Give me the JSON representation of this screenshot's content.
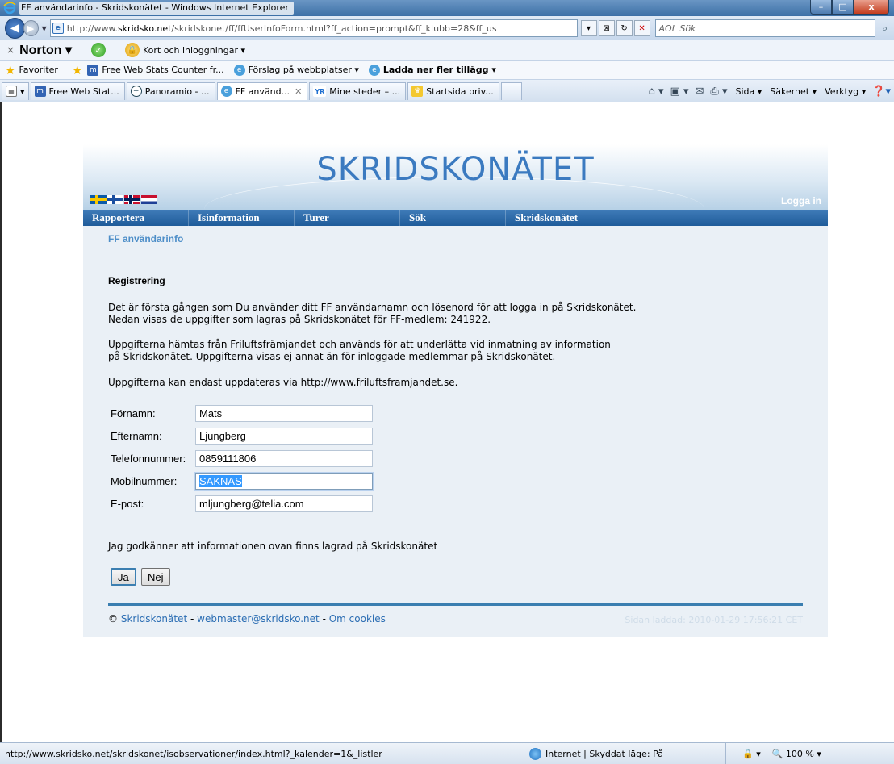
{
  "window": {
    "title": "FF användarinfo - Skridskonätet - Windows Internet Explorer",
    "min": "–",
    "max": "□",
    "close": "x"
  },
  "addressbar": {
    "url_prefix": "http://www.",
    "url_domain": "skridsko.net",
    "url_rest": "/skridskonet/ff/ffUserInfoForm.html?ff_action=prompt&ff_klubb=28&ff_us",
    "search_placeholder": "AOL Sök"
  },
  "norton": {
    "brand": "Norton",
    "identity_label": "Kort och inloggningar ▾"
  },
  "favorites": {
    "label": "Favoriter",
    "items": [
      {
        "label": "Free Web Stats Counter fr...",
        "icon": "m"
      },
      {
        "label": "Förslag på webbplatser ▾",
        "icon": "ie"
      },
      {
        "label": "Ladda ner fler tillägg ▾",
        "icon": "ie",
        "bold": true
      }
    ]
  },
  "tabs": [
    {
      "label": "Free Web Stat...",
      "icon": "m"
    },
    {
      "label": "Panoramio - ...",
      "icon": "pano"
    },
    {
      "label": "FF använd...",
      "icon": "ie",
      "active": true
    },
    {
      "label": "Mine steder – ...",
      "icon": "yr"
    },
    {
      "label": "Startsida priv...",
      "icon": "home"
    }
  ],
  "commands": {
    "page": "Sida ▾",
    "safety": "Säkerhet ▾",
    "tools": "Verktyg ▾"
  },
  "site": {
    "logo": "SKRIDSKONÄTET",
    "login": "Logga in",
    "menu": [
      "Rapportera",
      "Isinformation",
      "Turer",
      "Sök",
      "Skridskonätet"
    ],
    "subtitle": "FF användarinfo",
    "heading": "Registrering",
    "para1_line1": "Det är första gången som Du använder ditt FF användarnamn och lösenord för att logga in på Skridskonätet.",
    "para1_line2": "Nedan visas de uppgifter som lagras på Skridskonätet för FF-medlem: 241922.",
    "para2_line1": "Uppgifterna hämtas från Friluftsfrämjandet och används för att underlätta vid inmatning av information",
    "para2_line2": "på Skridskonätet. Uppgifterna visas ej annat än för inloggade medlemmar på Skridskonätet.",
    "para3": "Uppgifterna kan endast uppdateras via http://www.friluftsframjandet.se.",
    "form": [
      {
        "label": "Förnamn:",
        "value": "Mats"
      },
      {
        "label": "Efternamn:",
        "value": "Ljungberg"
      },
      {
        "label": "Telefonnummer:",
        "value": "0859111806"
      },
      {
        "label": "Mobilnummer:",
        "value": "SAKNAS",
        "selected": true
      },
      {
        "label": "E-post:",
        "value": "mljungberg@telia.com"
      }
    ],
    "agree": "Jag godkänner att informationen ovan finns lagrad på Skridskonätet",
    "yes": "Ja",
    "no": "Nej",
    "footer": {
      "copyright": "©",
      "link1": "Skridskonätet",
      "sep": " - ",
      "link2": "webmaster@skridsko.net",
      "link3": "Om cookies",
      "loaded": "Sidan laddad: 2010-01-29 17:56:21 CET"
    }
  },
  "status": {
    "url": "http://www.skridsko.net/skridskonet/isobservationer/index.html?_kalender=1&_listler",
    "zone": "Internet | Skyddat läge: På",
    "zoom": "100 %"
  }
}
